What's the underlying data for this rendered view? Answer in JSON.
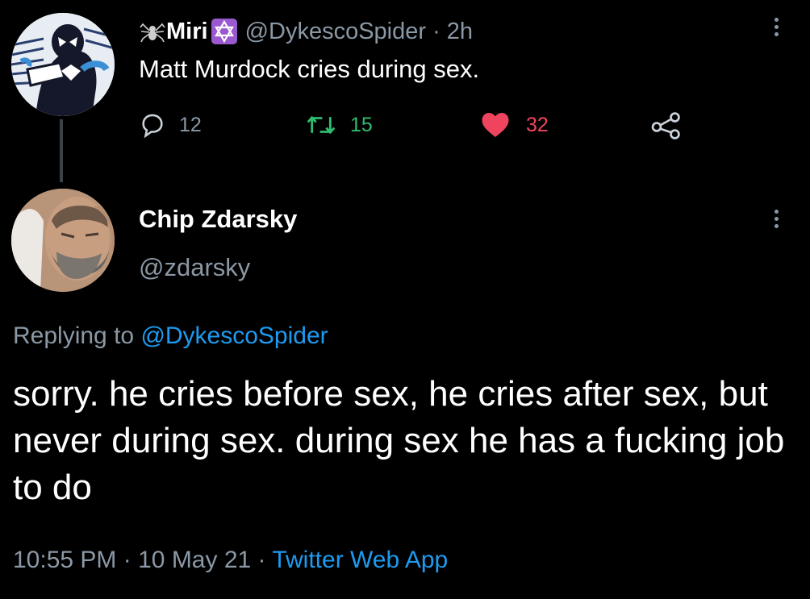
{
  "parent_tweet": {
    "display_name": "Miri",
    "name_emoji_icons": [
      "spider-icon",
      "star-of-david-icon"
    ],
    "handle": "@DykescoSpider",
    "time": "· 2h",
    "text": "Matt Murdock cries during sex.",
    "replies": "12",
    "retweets": "15",
    "likes": "32",
    "colors": {
      "retweet": "#2fbc70",
      "like": "#f0445e",
      "muted": "#8b98a5"
    }
  },
  "reply_tweet": {
    "display_name": "Chip Zdarsky",
    "handle": "@zdarsky",
    "replying_label": "Replying to",
    "replying_handle": "@DykescoSpider",
    "text": "sorry. he cries before sex, he cries after sex, but never during sex. during sex he has a fucking job to do",
    "time": "10:55 PM",
    "date": "10 May 21",
    "source": "Twitter Web App",
    "separator": "·",
    "colors": {
      "link": "#1d9bf0"
    }
  }
}
